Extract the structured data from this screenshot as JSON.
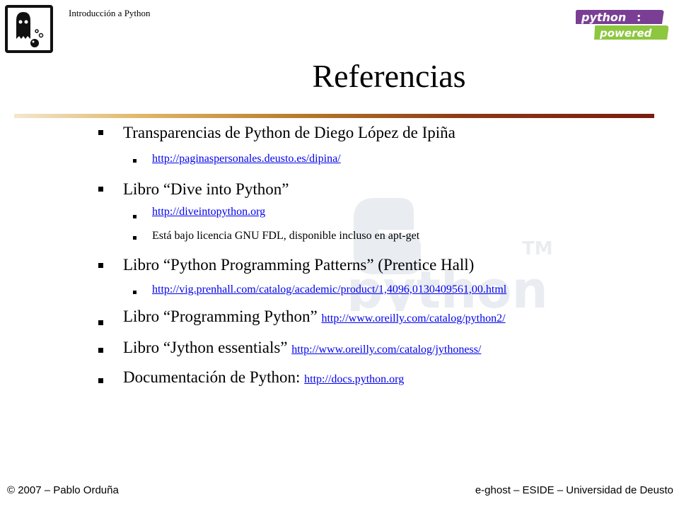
{
  "header": {
    "title": "Introducción a Python"
  },
  "slide": {
    "title": "Referencias"
  },
  "content": {
    "b1": {
      "text": "Transparencias de Python de Diego López de Ipiña",
      "link": "http://paginaspersonales.deusto.es/dipina/"
    },
    "b2": {
      "text": "Libro “Dive into Python”",
      "link": "http://diveintopython.org",
      "note": "Está bajo licencia GNU FDL, disponible incluso en apt-get"
    },
    "b3": {
      "text": "Libro “Python Programming Patterns” (Prentice Hall)",
      "link": "http://vig.prenhall.com/catalog/academic/product/1,4096,0130409561,00.html"
    },
    "b4": {
      "text": "Libro “Programming Python” ",
      "link": "http://www.oreilly.com/catalog/python2/"
    },
    "b5": {
      "text": "Libro “Jython essentials” ",
      "link": "http://www.oreilly.com/catalog/jythoness/"
    },
    "b6": {
      "text": "Documentación de Python: ",
      "link": "http://docs.python.org"
    }
  },
  "badge": {
    "line1": "python",
    "colon": ":",
    "line2": "powered"
  },
  "watermark": {
    "text": "python",
    "tm": "TM"
  },
  "footer": {
    "left": "© 2007 – Pablo Orduña",
    "right": "e-ghost – ESIDE – Universidad de Deusto"
  },
  "colors": {
    "link": "#0000ee",
    "badge_purple": "#7a3f94",
    "badge_green": "#8dc63f",
    "rule_dark": "#7a1c10",
    "rule_light": "#f3e7cf"
  }
}
